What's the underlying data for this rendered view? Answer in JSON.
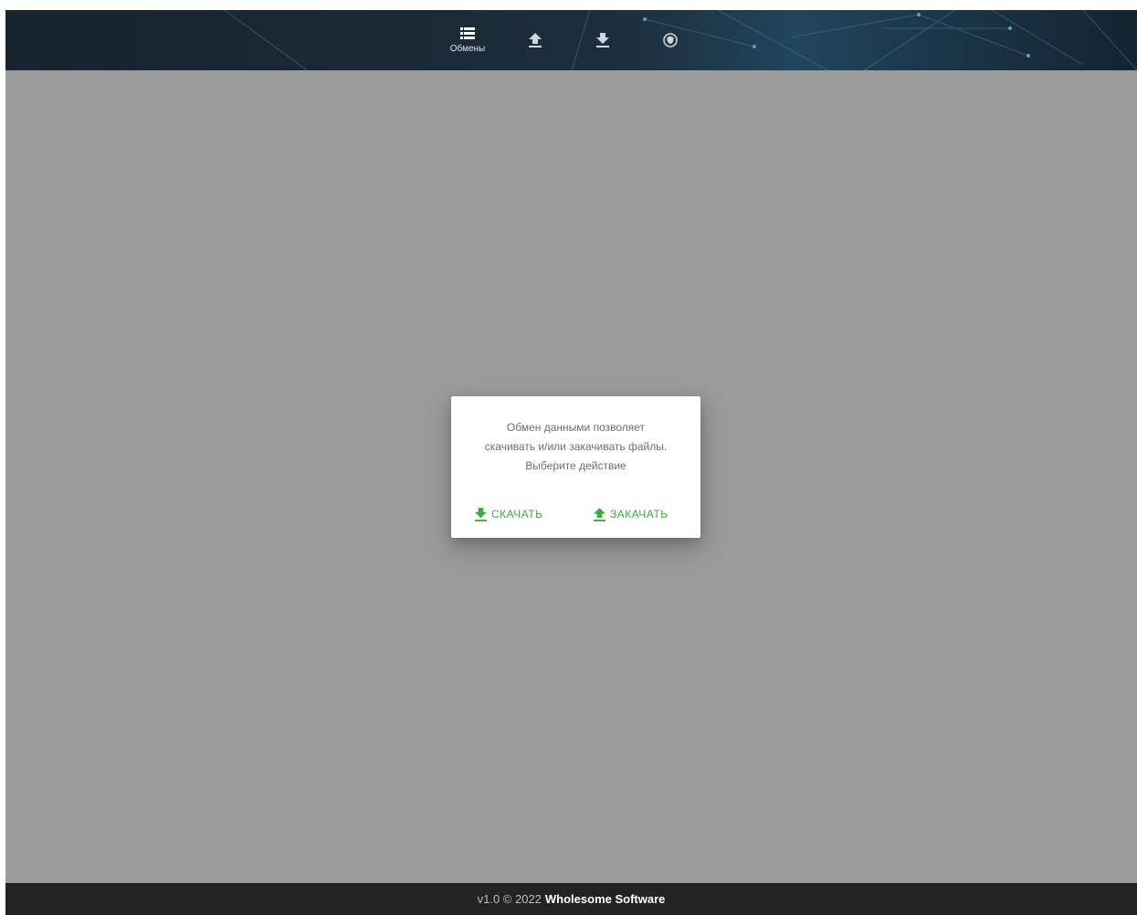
{
  "nav": {
    "items": [
      {
        "icon": "list-icon",
        "label": "Обмены",
        "active": true
      },
      {
        "icon": "upload-icon"
      },
      {
        "icon": "download-icon"
      },
      {
        "icon": "shield-icon"
      }
    ]
  },
  "dialog": {
    "lines": [
      "Обмен данными позволяет",
      "скачивать и/или закачивать файлы.",
      "Выберите действие"
    ],
    "download_label": "СКАЧАТЬ",
    "upload_label": "ЗАКАЧАТЬ",
    "accent_color": "#3daa3d"
  },
  "footer": {
    "version_text": "v1.0 © 2022",
    "company": "Wholesome Software"
  }
}
